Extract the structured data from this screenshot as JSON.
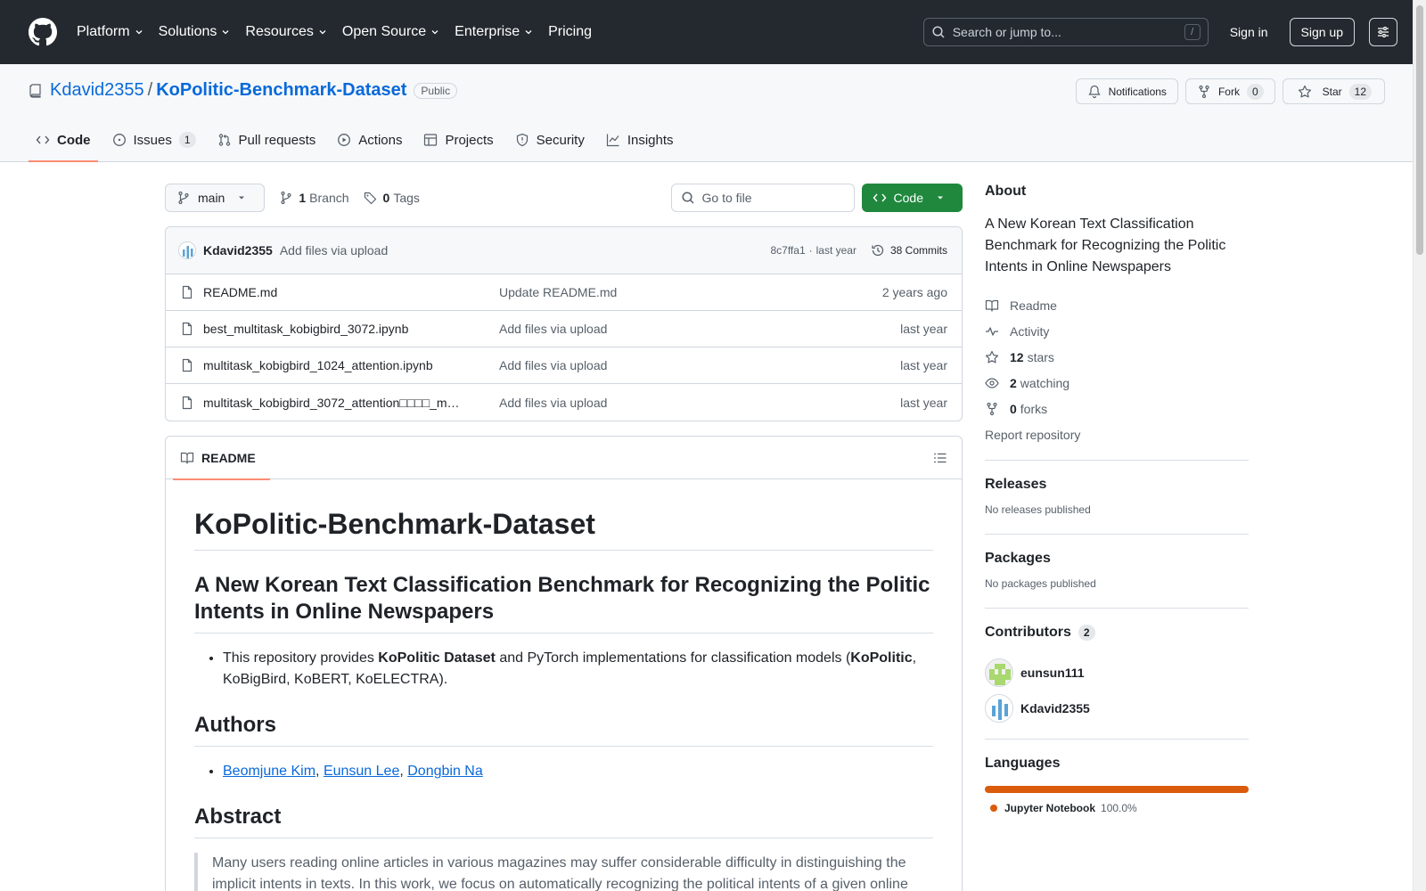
{
  "header": {
    "nav": [
      {
        "label": "Platform",
        "dropdown": true
      },
      {
        "label": "Solutions",
        "dropdown": true
      },
      {
        "label": "Resources",
        "dropdown": true
      },
      {
        "label": "Open Source",
        "dropdown": true
      },
      {
        "label": "Enterprise",
        "dropdown": true
      },
      {
        "label": "Pricing",
        "dropdown": false
      }
    ],
    "search_placeholder": "Search or jump to...",
    "search_shortcut": "/",
    "sign_in": "Sign in",
    "sign_up": "Sign up"
  },
  "repo": {
    "owner": "Kdavid2355",
    "separator": "/",
    "name": "KoPolitic-Benchmark-Dataset",
    "visibility": "Public",
    "notifications_label": "Notifications",
    "fork_label": "Fork",
    "fork_count": "0",
    "star_label": "Star",
    "star_count": "12"
  },
  "tabs": {
    "code": "Code",
    "issues": "Issues",
    "issues_count": "1",
    "pulls": "Pull requests",
    "actions": "Actions",
    "projects": "Projects",
    "security": "Security",
    "insights": "Insights"
  },
  "toolbar": {
    "branch": "main",
    "branch_count": "1",
    "branch_label": "Branch",
    "tag_count": "0",
    "tag_label": "Tags",
    "goto_placeholder": "Go to file",
    "code_button": "Code"
  },
  "latest_commit": {
    "author": "Kdavid2355",
    "message": "Add files via upload",
    "hash": "8c7ffa1",
    "dot": "·",
    "date": "last year",
    "commits_count": "38 Commits"
  },
  "files": [
    {
      "name": "README.md",
      "message": "Update README.md",
      "date": "2 years ago"
    },
    {
      "name": "best_multitask_kobigbird_3072.ipynb",
      "message": "Add files via upload",
      "date": "last year"
    },
    {
      "name": "multitask_kobigbird_1024_attention.ipynb",
      "message": "Add files via upload",
      "date": "last year"
    },
    {
      "name": "multitask_kobigbird_3072_attention□□□□_m…",
      "message": "Add files via upload",
      "date": "last year"
    }
  ],
  "readme": {
    "tab": "README",
    "h1": "KoPolitic-Benchmark-Dataset",
    "h2": "A New Korean Text Classification Benchmark for Recognizing the Politic Intents in Online Newspapers",
    "bullet_1_a": "This repository provides ",
    "bullet_1_b": "KoPolitic Dataset",
    "bullet_1_c": " and PyTorch implementations for classification models (",
    "bullet_1_d": "KoPolitic",
    "bullet_1_e": ", KoBigBird, KoBERT, KoELECTRA).",
    "authors_h": "Authors",
    "author_1": "Beomjune Kim",
    "author_2": "Eunsun Lee",
    "author_3": "Dongbin Na",
    "comma": ", ",
    "abstract_h": "Abstract",
    "abstract": "Many users reading online articles in various magazines may suffer considerable difficulty in distinguishing the implicit intents in texts. In this work, we focus on automatically recognizing the political intents of a given online"
  },
  "sidebar": {
    "about_h": "About",
    "about_text": "A New Korean Text Classification Benchmark for Recognizing the Politic Intents in Online Newspapers",
    "readme": "Readme",
    "activity": "Activity",
    "stars_count": "12",
    "stars_label": "stars",
    "watching_count": "2",
    "watching_label": "watching",
    "forks_count": "0",
    "forks_label": "forks",
    "report": "Report repository",
    "releases_h": "Releases",
    "releases_text": "No releases published",
    "packages_h": "Packages",
    "packages_text": "No packages published",
    "contributors_h": "Contributors",
    "contributors_count": "2",
    "contributors": [
      "eunsun111",
      "Kdavid2355"
    ],
    "languages_h": "Languages",
    "language": "Jupyter Notebook",
    "language_pct": "100.0%",
    "language_color": "#DA5B0B"
  }
}
